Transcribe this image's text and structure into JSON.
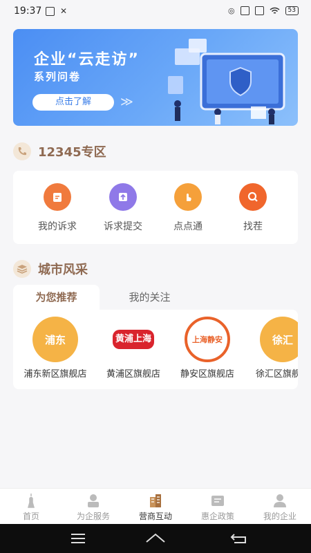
{
  "status_bar": {
    "time": "19:37",
    "battery": "53"
  },
  "banner": {
    "title": "企业“云走访”",
    "subtitle": "系列问卷",
    "button_label": "点击了解",
    "arrows": "≫"
  },
  "section_12345": {
    "title": "12345专区"
  },
  "services": [
    {
      "label": "我的诉求",
      "color": "#f07a3d"
    },
    {
      "label": "诉求提交",
      "color": "#8f79e8"
    },
    {
      "label": "点点通",
      "color": "#f5a03a"
    },
    {
      "label": "找茬",
      "color": "#f0662c"
    }
  ],
  "section_city": {
    "title": "城市风采"
  },
  "tabs": {
    "active": "为您推荐",
    "inactive": "我的关注"
  },
  "stores": [
    {
      "name": "浦东新区旗舰店",
      "logo_text": "浦东",
      "color": "#f5b346"
    },
    {
      "name": "黄浦区旗舰店",
      "logo_text": "黄浦上海",
      "color": "#d9242d"
    },
    {
      "name": "静安区旗舰店",
      "logo_text": "上海静安",
      "color": "#e9622a"
    },
    {
      "name": "徐汇区旗舰店",
      "logo_text": "徐汇",
      "color": "#f5b346"
    }
  ],
  "bottom_nav": [
    {
      "label": "首页",
      "icon": "tower-icon"
    },
    {
      "label": "为企服务",
      "icon": "service-icon"
    },
    {
      "label": "营商互动",
      "icon": "building-icon",
      "active": true
    },
    {
      "label": "惠企政策",
      "icon": "policy-icon"
    },
    {
      "label": "我的企业",
      "icon": "user-icon"
    }
  ],
  "colors": {
    "accent_brown": "#8f6a52",
    "banner_blue": "#4b8ef3",
    "active_nav": "#c8925a"
  }
}
